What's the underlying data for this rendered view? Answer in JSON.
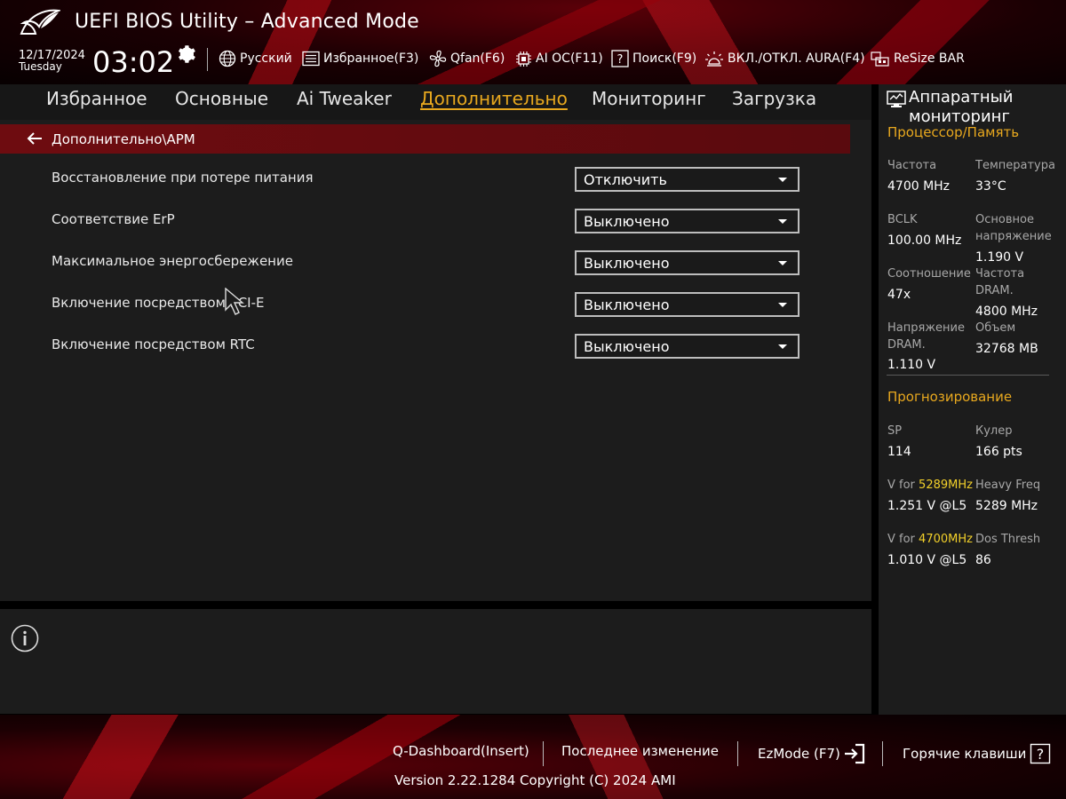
{
  "header": {
    "title": "UEFI BIOS Utility – Advanced Mode",
    "date": "12/17/2024",
    "day": "Tuesday",
    "time": "03:02",
    "items": [
      {
        "label": "Русский"
      },
      {
        "label": "Избранное(F3)"
      },
      {
        "label": "Qfan(F6)"
      },
      {
        "label": "AI OC(F11)"
      },
      {
        "label": "Поиск(F9)"
      },
      {
        "label": "ВКЛ./ОТКЛ. AURA(F4)"
      },
      {
        "label": "ReSize BAR"
      }
    ]
  },
  "tabs": [
    {
      "label": "Избранное"
    },
    {
      "label": "Основные"
    },
    {
      "label": "Ai Tweaker"
    },
    {
      "label": "Дополнительно",
      "active": true
    },
    {
      "label": "Мониторинг"
    },
    {
      "label": "Загрузка"
    }
  ],
  "main": {
    "breadcrumb": "Дополнительно\\APM",
    "settings": [
      {
        "label": "Восстановление при потере питания",
        "value": "Отключить"
      },
      {
        "label": "Соответствие ErP",
        "value": "Выключено"
      },
      {
        "label": "Максимальное энергосбережение",
        "value": "Выключено"
      },
      {
        "label": "Включение посредством PCI-E",
        "value": "Выключено"
      },
      {
        "label": "Включение посредством RTC",
        "value": "Выключено"
      }
    ]
  },
  "sidebar": {
    "title": "Аппаратный мониторинг",
    "cpu_section": "Процессор/Память",
    "cpu_items": [
      {
        "label": "Частота",
        "value": "4700 MHz"
      },
      {
        "label": "Температура",
        "value": "33°C"
      },
      {
        "label": "BCLK",
        "value": "100.00 MHz"
      },
      {
        "label": "Основное напряжение",
        "value": "1.190 V"
      },
      {
        "label": "Соотношение",
        "value": "47x"
      },
      {
        "label": "Частота DRAM.",
        "value": "4800 MHz"
      },
      {
        "label": "Напряжение DRAM.",
        "value": "1.110 V"
      },
      {
        "label": "Объем",
        "value": "32768 MB"
      }
    ],
    "predict_section": "Прогнозирование",
    "predict_items": [
      {
        "label": "SP",
        "value": "114"
      },
      {
        "label": "Кулер",
        "value": "166 pts"
      },
      {
        "label_prefix": "V for ",
        "label_highlight": "5289MHz",
        "value": "1.251 V @L5"
      },
      {
        "label": "Heavy Freq",
        "value": "5289 MHz"
      },
      {
        "label_prefix": "V for ",
        "label_highlight": "4700MHz",
        "value": "1.010 V @L5"
      },
      {
        "label": "Dos Thresh",
        "value": "86"
      }
    ]
  },
  "footer": {
    "items": [
      {
        "label": "Q-Dashboard(Insert)"
      },
      {
        "label": "Последнее изменение"
      },
      {
        "label": "EzMode (F7)"
      },
      {
        "label": "Горячие клавиши"
      }
    ],
    "version": "Version 2.22.1284 Copyright (C) 2024 AMI"
  },
  "colors": {
    "accent": "#e8a81e",
    "highlight": "#f2d02a",
    "brand_red": "#6e0c10"
  }
}
